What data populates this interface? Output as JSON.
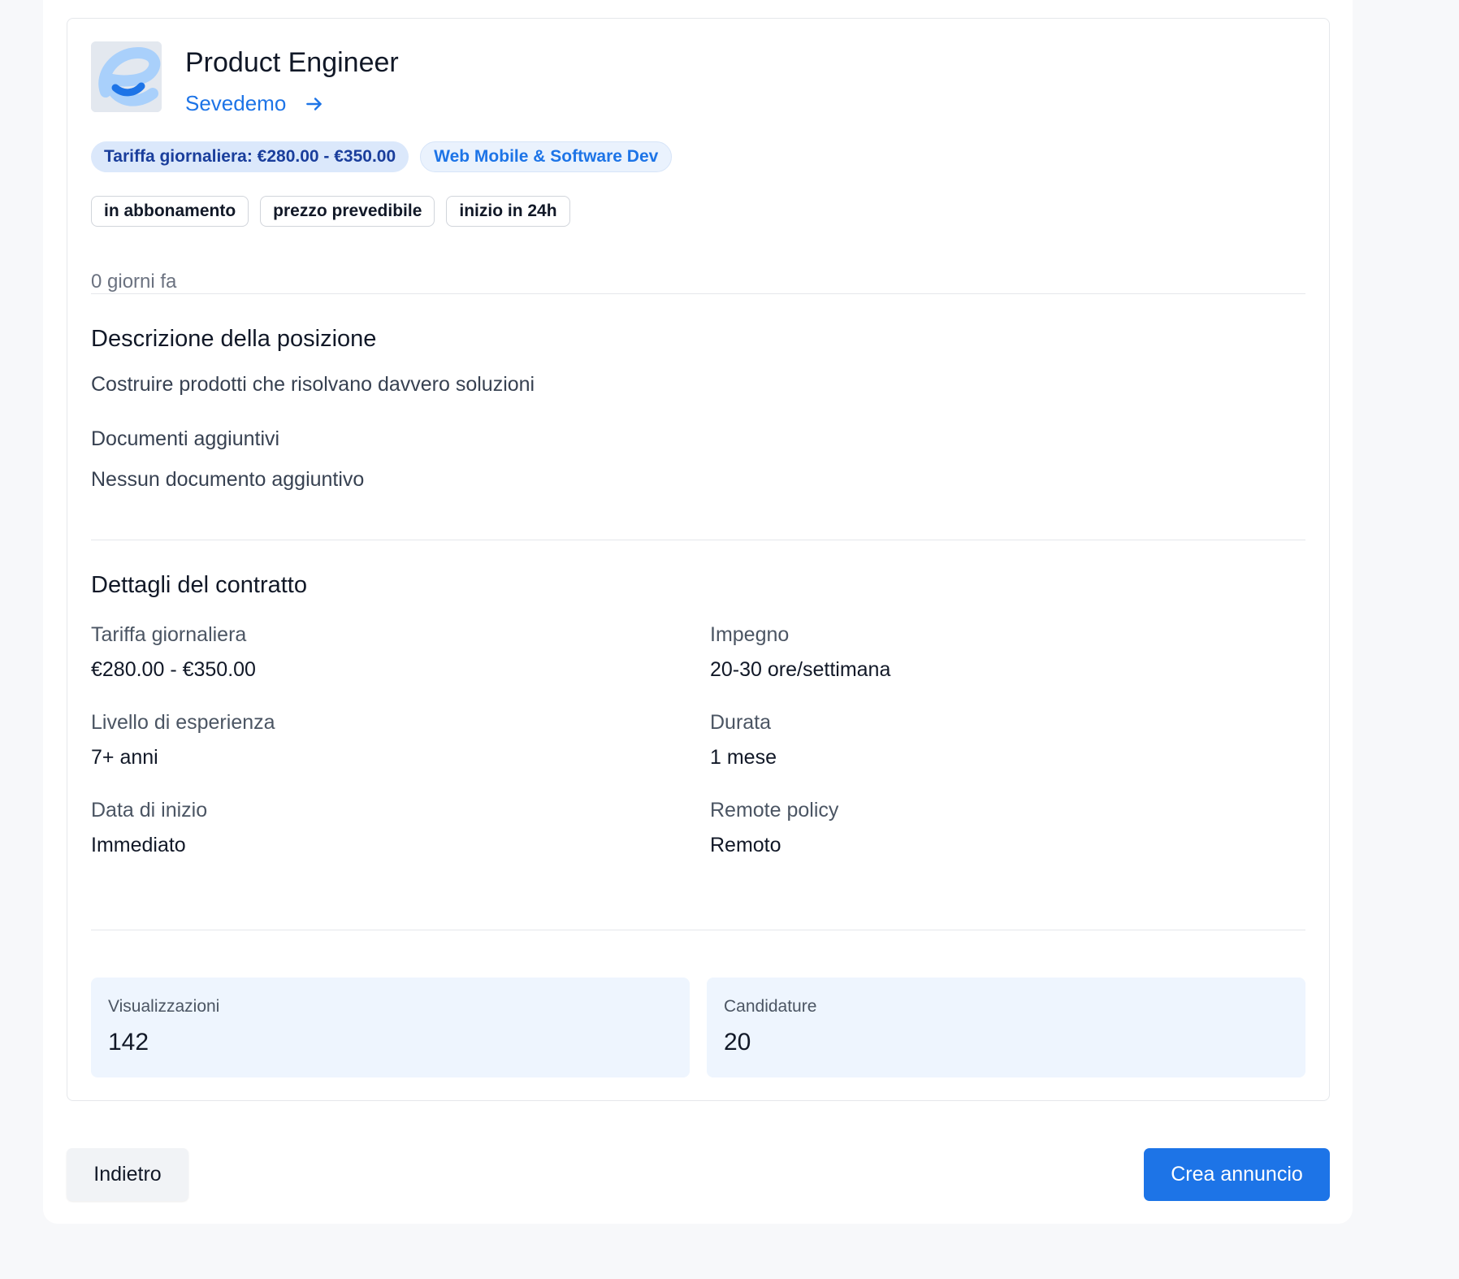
{
  "job": {
    "title": "Product Engineer",
    "company": "Sevedemo",
    "logo_icon": "company-logo-letter-e",
    "badges": {
      "rate": "Tariffa giornaliera: €280.00 - €350.00",
      "category": "Web Mobile & Software Dev"
    },
    "tags": [
      "in abbonamento",
      "prezzo prevedibile",
      "inizio in 24h"
    ],
    "posted": "0 giorni fa"
  },
  "description": {
    "heading": "Descrizione della posizione",
    "body": "Costruire prodotti che risolvano davvero soluzioni",
    "docs_label": "Documenti aggiuntivi",
    "docs_value": "Nessun documento aggiuntivo"
  },
  "contract": {
    "heading": "Dettagli del contratto",
    "daily_rate_label": "Tariffa giornaliera",
    "daily_rate_value": "€280.00 - €350.00",
    "commitment_label": "Impegno",
    "commitment_value": "20-30 ore/settimana",
    "experience_label": "Livello di esperienza",
    "experience_value": "7+ anni",
    "duration_label": "Durata",
    "duration_value": "1 mese",
    "start_label": "Data di inizio",
    "start_value": "Immediato",
    "remote_label": "Remote policy",
    "remote_value": "Remoto"
  },
  "stats": {
    "views_label": "Visualizzazioni",
    "views_value": "142",
    "applications_label": "Candidature",
    "applications_value": "20"
  },
  "actions": {
    "back_label": "Indietro",
    "create_label": "Crea annuncio"
  },
  "colors": {
    "accent": "#1d74e7",
    "rate_badge_bg": "#dbe8fb",
    "rate_badge_text": "#1a3e9c",
    "stat_bg": "#eef5fe"
  }
}
